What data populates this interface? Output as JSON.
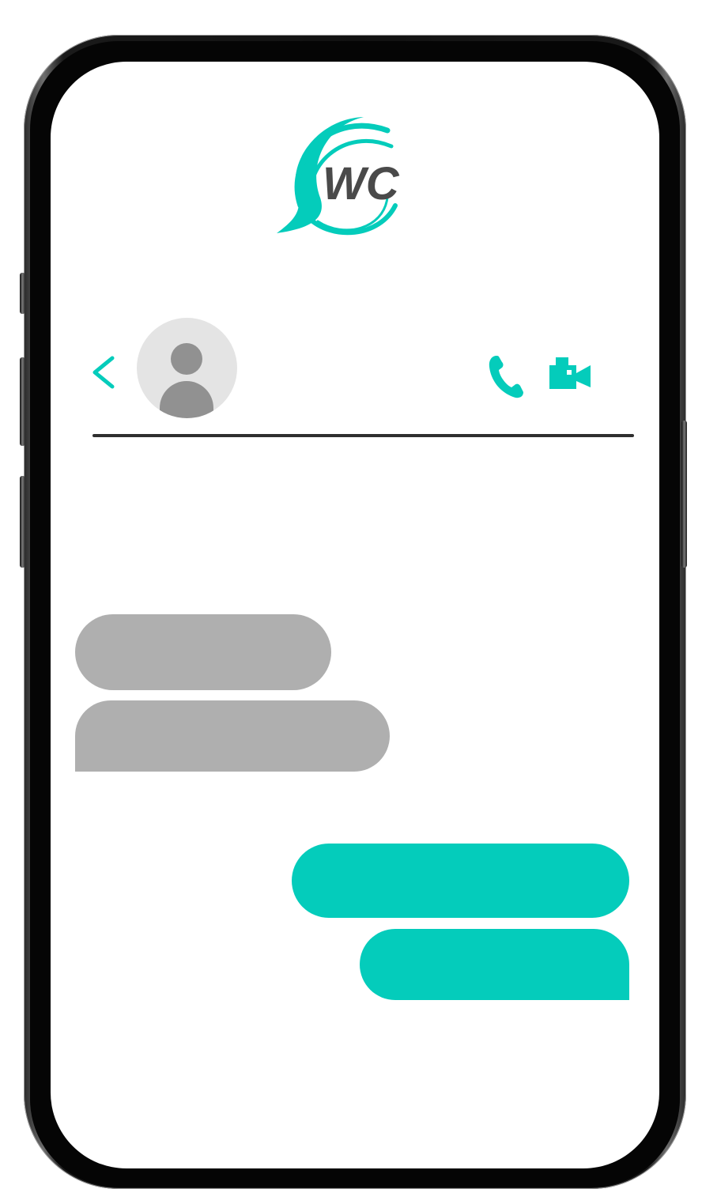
{
  "app": {
    "logo_text": "WC"
  },
  "colors": {
    "accent": "#04ccbb",
    "incoming_bubble": "#afafaf",
    "avatar_bg": "#e4e4e4",
    "avatar_figure": "#919191",
    "logo_text": "#4a4a4a",
    "divider": "#2f2f2f"
  },
  "header": {
    "back_icon": "chevron-left-icon",
    "avatar_icon": "person-icon",
    "actions": [
      {
        "icon": "phone-icon"
      },
      {
        "icon": "video-camera-icon"
      }
    ]
  },
  "messages": [
    {
      "direction": "incoming",
      "text": ""
    },
    {
      "direction": "incoming",
      "text": ""
    },
    {
      "direction": "outgoing",
      "text": ""
    },
    {
      "direction": "outgoing",
      "text": ""
    }
  ]
}
